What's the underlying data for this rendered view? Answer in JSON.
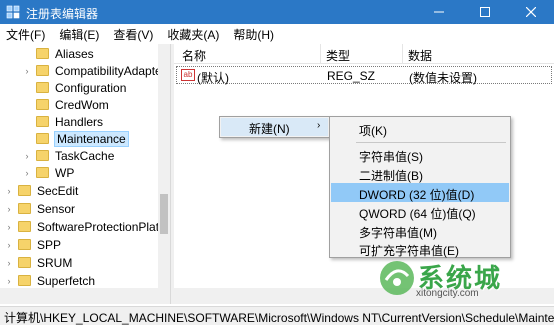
{
  "window": {
    "title": "注册表编辑器"
  },
  "menu": [
    "文件(F)",
    "编辑(E)",
    "查看(V)",
    "收藏夹(A)",
    "帮助(H)"
  ],
  "tree": {
    "items": [
      {
        "label": "Aliases",
        "expandable": false
      },
      {
        "label": "CompatibilityAdapte",
        "expandable": true
      },
      {
        "label": "Configuration",
        "expandable": false
      },
      {
        "label": "CredWom",
        "expandable": false
      },
      {
        "label": "Handlers",
        "expandable": false
      },
      {
        "label": "Maintenance",
        "expandable": false,
        "selected": true
      },
      {
        "label": "TaskCache",
        "expandable": true
      },
      {
        "label": "WP",
        "expandable": true
      },
      {
        "label": "SecEdit",
        "expandable": true
      },
      {
        "label": "Sensor",
        "expandable": true
      },
      {
        "label": "SoftwareProtectionPlatf",
        "expandable": true
      },
      {
        "label": "SPP",
        "expandable": true
      },
      {
        "label": "SRUM",
        "expandable": true
      },
      {
        "label": "Superfetch",
        "expandable": true
      }
    ]
  },
  "list": {
    "headers": {
      "name": "名称",
      "type": "类型",
      "data": "数据"
    },
    "rows": [
      {
        "icon": "ab",
        "name": "(默认)",
        "type": "REG_SZ",
        "data": "(数值未设置)"
      }
    ]
  },
  "context_menu": {
    "parent_label": "新建(N)",
    "parent_arrow": "›",
    "submenu": [
      "项(K)",
      "字符串值(S)",
      "二进制值(B)",
      "DWORD (32 位)值(D)",
      "QWORD (64 位)值(Q)",
      "多字符串值(M)",
      "可扩充字符串值(E)"
    ],
    "highlighted_index": 3
  },
  "statusbar": {
    "path": "计算机\\HKEY_LOCAL_MACHINE\\SOFTWARE\\Microsoft\\Windows NT\\CurrentVersion\\Schedule\\Maintenance"
  },
  "watermark": {
    "text": "系统城",
    "sub": "xitongcity.com"
  },
  "colors": {
    "titlebar": "#2b78c6",
    "highlight": "#91c9f7",
    "selection": "#cce8ff"
  }
}
